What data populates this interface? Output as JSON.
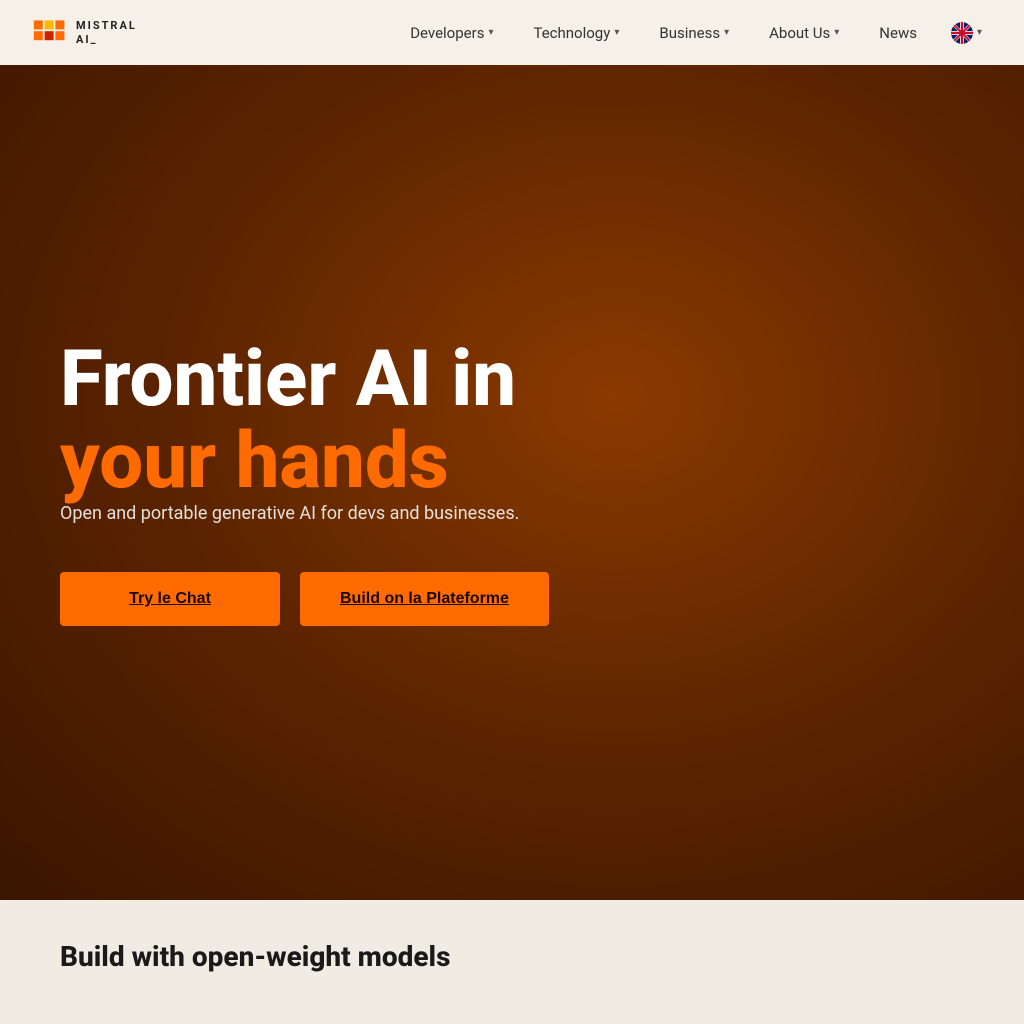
{
  "navbar": {
    "logo_text_line1": "MISTRAL",
    "logo_text_line2": "AI_",
    "nav_items": [
      {
        "label": "Developers",
        "has_dropdown": true
      },
      {
        "label": "Technology",
        "has_dropdown": true
      },
      {
        "label": "Business",
        "has_dropdown": true
      },
      {
        "label": "About Us",
        "has_dropdown": true
      },
      {
        "label": "News",
        "has_dropdown": false
      }
    ],
    "lang_label": "EN"
  },
  "hero": {
    "title_line1": "Frontier AI in",
    "title_line2": "your hands",
    "subtitle": "Open and portable generative AI for devs and businesses.",
    "btn_chat_label": "Try le Chat",
    "btn_platform_label": "Build on la Plateforme"
  },
  "bottom": {
    "title": "Build with open-weight models"
  },
  "colors": {
    "orange": "#FF6B00",
    "dark_brown": "#3A1500",
    "nav_bg": "#f5f0e8",
    "bottom_bg": "#f0ece4"
  }
}
